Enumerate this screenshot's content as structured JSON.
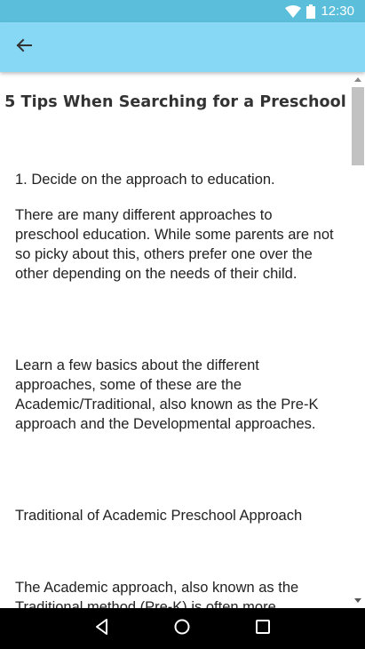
{
  "status_bar": {
    "time": "12:30",
    "icons": [
      "wifi-icon",
      "battery-icon"
    ]
  },
  "app_bar": {
    "back_icon": "arrow-left-icon"
  },
  "article": {
    "title": "5 Tips When Searching for a Preschool",
    "paragraphs": [
      "1. Decide on the approach to education.",
      "There are many different approaches to preschool education. While some parents are not so picky about this, others prefer one over the other depending on the needs of their child.",
      "Learn a few basics about the different approaches, some of these are the Academic/Traditional, also known as the Pre-K approach and the Developmental approaches.",
      "Traditional of Academic Preschool Approach",
      "The Academic approach, also known as the Traditional method (Pre-K) is often more"
    ]
  },
  "nav_bar": {
    "icons": [
      "back-triangle-icon",
      "home-circle-icon",
      "recents-square-icon"
    ]
  },
  "colors": {
    "status_bar": "#5bbfdb",
    "app_bar": "#87d8f5",
    "nav_bar": "#000000"
  }
}
